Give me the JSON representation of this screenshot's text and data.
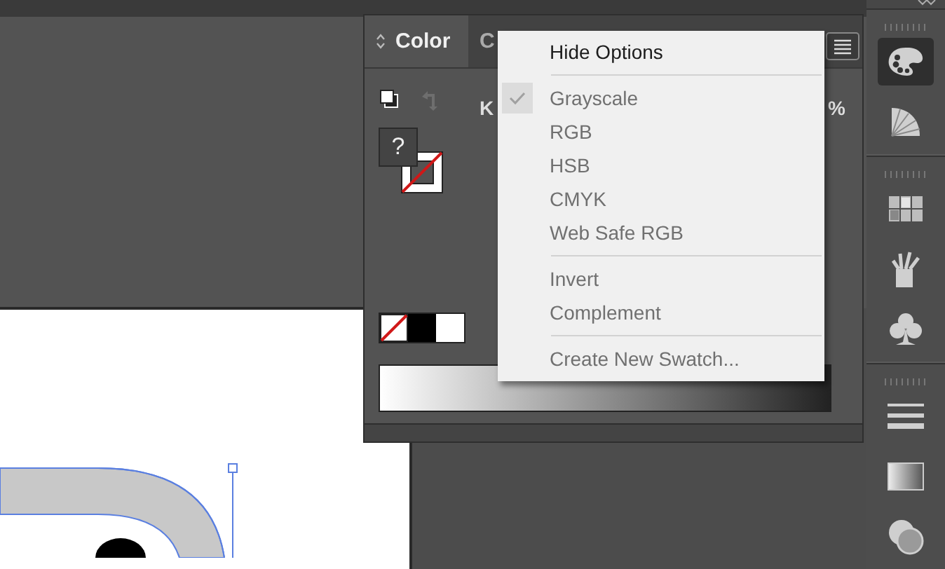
{
  "panel": {
    "tabs": [
      {
        "label": "Color",
        "selected": true
      },
      {
        "label": "C",
        "selected": false
      }
    ],
    "fill_unknown": "?",
    "slider_label": "K",
    "slider_unit": "%"
  },
  "menu": {
    "items": [
      {
        "kind": "command",
        "label": "Hide Options",
        "checked": false,
        "disabled": false
      },
      {
        "kind": "separator"
      },
      {
        "kind": "command",
        "label": "Grayscale",
        "checked": true,
        "disabled": true
      },
      {
        "kind": "command",
        "label": "RGB",
        "checked": false,
        "disabled": true
      },
      {
        "kind": "command",
        "label": "HSB",
        "checked": false,
        "disabled": true
      },
      {
        "kind": "command",
        "label": "CMYK",
        "checked": false,
        "disabled": true
      },
      {
        "kind": "command",
        "label": "Web Safe RGB",
        "checked": false,
        "disabled": true
      },
      {
        "kind": "separator"
      },
      {
        "kind": "command",
        "label": "Invert",
        "checked": false,
        "disabled": true
      },
      {
        "kind": "command",
        "label": "Complement",
        "checked": false,
        "disabled": true
      },
      {
        "kind": "separator"
      },
      {
        "kind": "command",
        "label": "Create New Swatch...",
        "checked": false,
        "disabled": true
      }
    ]
  },
  "dock": {
    "groups": [
      [
        {
          "kind": "palette",
          "selected": true
        },
        {
          "kind": "guide",
          "selected": false
        }
      ],
      [
        {
          "kind": "swatches",
          "selected": false
        },
        {
          "kind": "brushes",
          "selected": false
        },
        {
          "kind": "symbols",
          "selected": false
        }
      ],
      [
        {
          "kind": "stroke",
          "selected": false
        },
        {
          "kind": "gradient",
          "selected": false
        },
        {
          "kind": "transparency",
          "selected": false
        }
      ]
    ]
  }
}
